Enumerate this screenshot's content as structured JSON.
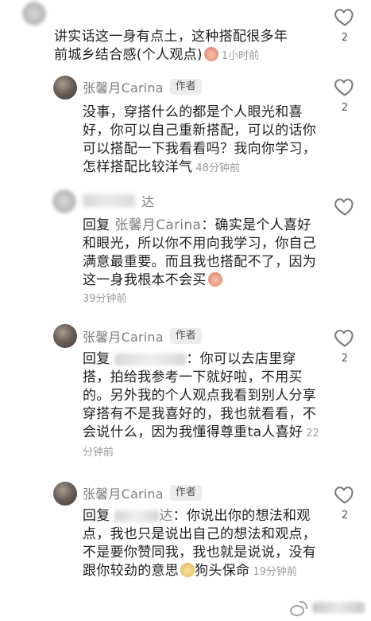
{
  "comments": [
    {
      "text": "讲实话这一身有点土，这种搭配很多年前城乡结合感(个人观点)",
      "time": "1小时前",
      "likes": "2"
    },
    {
      "name": "张馨月Carina",
      "badge": "作者",
      "text": "没事，穿搭什么的都是个人眼光和喜好，你可以自己重新搭配，可以的话你可以搭配一下我看看吗？我向你学习，怎样搭配比较洋气",
      "time": "48分钟前",
      "likes": "2"
    },
    {
      "name_tail": "达",
      "reply_prefix": "回复",
      "reply_to": "张馨月Carina",
      "text": "：确实是个人喜好和眼光，所以你不用向我学习，你自己满意最重要。而且我也搭配不了，因为这一身我根本不会买",
      "time": "39分钟前"
    },
    {
      "name": "张馨月Carina",
      "badge": "作者",
      "reply_prefix": "回复",
      "text": "：你可以去店里穿搭，拍给我参考一下就好啦，不用买的。另外我的个人观点我看到别人分享穿搭有不是我喜好的，我也就看看，不会说什么，因为我懂得尊重ta人喜好",
      "time": "22分钟前",
      "likes": "2"
    },
    {
      "name": "张馨月Carina",
      "badge": "作者",
      "reply_prefix": "回复",
      "reply_to_tail": "达",
      "text": "：你说出你的想法和观点，我也只是说出自己的想法和观点，不是要你赞同我，我也就是说说，没有跟你较劲的意思",
      "text_tail": "狗头保命",
      "time": "19分钟前",
      "likes": "2"
    }
  ],
  "icons": {
    "heart": "heart-outline-icon",
    "emoji_1": "embarrassed-face-icon",
    "emoji_2": "cute-face-icon",
    "emoji_3": "dog-face-icon",
    "watermark": "weibo-logo-icon"
  },
  "colors": {
    "name": "#7e7e7e",
    "text": "#1f1f1f",
    "time": "#9a9a9a",
    "badge_bg": "#ececec"
  }
}
